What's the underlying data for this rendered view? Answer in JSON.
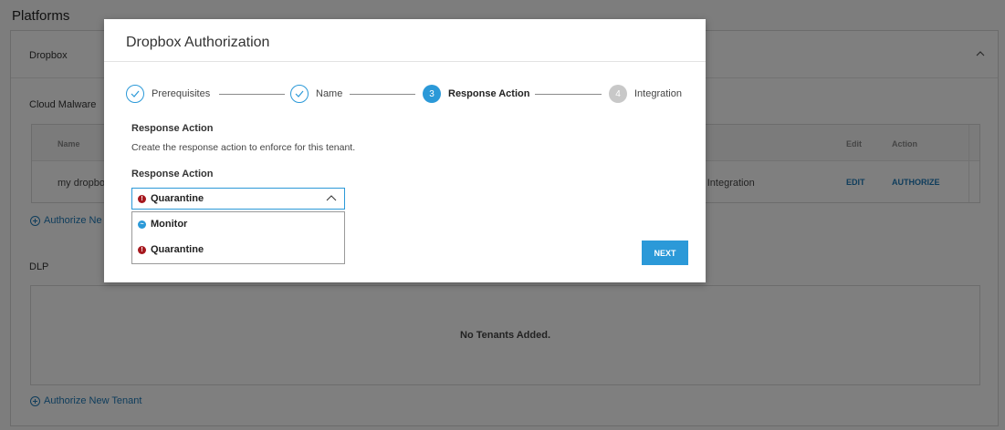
{
  "page": {
    "title": "Platforms",
    "dropbox_label": "Dropbox",
    "cloud_malware_label": "Cloud Malware",
    "dlp_label": "DLP",
    "table": {
      "headers": {
        "name": "Name",
        "edit": "Edit",
        "action": "Action"
      },
      "row": {
        "name": "my dropbox",
        "status": "ing Integration",
        "edit": "EDIT",
        "action": "AUTHORIZE"
      }
    },
    "authorize_link_1": "Authorize Ne",
    "authorize_link_2": "Authorize New Tenant",
    "no_tenants": "No Tenants Added."
  },
  "modal": {
    "title": "Dropbox Authorization",
    "steps": [
      {
        "label": "Prerequisites",
        "state": "done",
        "marker": ""
      },
      {
        "label": "Name",
        "state": "done",
        "marker": ""
      },
      {
        "label": "Response Action",
        "state": "active",
        "marker": "3"
      },
      {
        "label": "Integration",
        "state": "todo",
        "marker": "4"
      }
    ],
    "section_heading": "Response Action",
    "description": "Create the response action to enforce for this tenant.",
    "field_label": "Response Action",
    "select": {
      "value": "Quarantine",
      "value_icon": "quarantine-icon",
      "options": [
        {
          "label": "Monitor",
          "icon": "monitor-icon"
        },
        {
          "label": "Quarantine",
          "icon": "quarantine-icon"
        }
      ]
    },
    "next_label": "NEXT"
  },
  "colors": {
    "accent": "#2b99d8",
    "quarantine": "#a6181e",
    "link": "#1e7ab8"
  }
}
